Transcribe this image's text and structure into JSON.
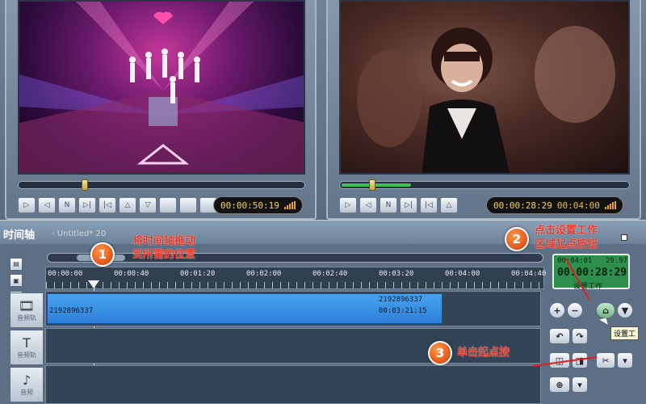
{
  "players": {
    "left": {
      "timecode": "00:00:50:19",
      "seek": 0.22,
      "controls": [
        "play-icon",
        "step-back-icon",
        "n-icon",
        "next-icon",
        "skip-icon",
        "up-icon",
        "down-icon",
        "blank-icon",
        "blank-icon",
        "blank-icon"
      ]
    },
    "right": {
      "timecode_main": "00:00:28:29",
      "timecode_total": "00:04:00",
      "seek": 0.1,
      "controls": [
        "play-icon",
        "step-back-icon",
        "n-icon",
        "next-icon",
        "skip-icon",
        "up-icon",
        "down-icon",
        "blank-icon",
        "blank-icon",
        "blank-icon",
        "car-icon"
      ]
    }
  },
  "timeline": {
    "title": "时间轴",
    "untitled": "- Untitled* 20",
    "ruler_ticks": [
      "00:00:00",
      "00:00:40",
      "00:01:20",
      "00:02:00",
      "00:02:40",
      "00:03:20",
      "00:04:00",
      "00:04:40"
    ],
    "tracks": [
      {
        "label": "音频轨",
        "icon": "video-track-icon"
      },
      {
        "label": "音频轨",
        "icon": "text-track-icon"
      },
      {
        "label": "音频",
        "icon": "audio-track-icon"
      }
    ],
    "clip": {
      "name_left": "2192896337",
      "name_right": "2192896337",
      "duration": "00:03:21;15"
    }
  },
  "time_panel": {
    "top_left": "00:04:01",
    "top_right": "29.97",
    "main": "00:00:28:29",
    "bottom": "设置工作"
  },
  "side_buttons": {
    "zoom_in": "+",
    "zoom_out": "−",
    "tooltip": "设置工"
  },
  "annotations": {
    "one": {
      "number": "1",
      "line1": "将时间轴拖动",
      "line2": "到所需的位置"
    },
    "two": {
      "number": "2",
      "line1": "点击设置工作",
      "line2": "区域起点按钮"
    },
    "three": {
      "number": "3",
      "line1": "单击起点按"
    }
  },
  "colors": {
    "accent_green": "#2c8f4b",
    "clip_blue": "#3a93e6",
    "annotation_red": "#e23a2a",
    "timecode_yellow": "#f2d35a"
  }
}
